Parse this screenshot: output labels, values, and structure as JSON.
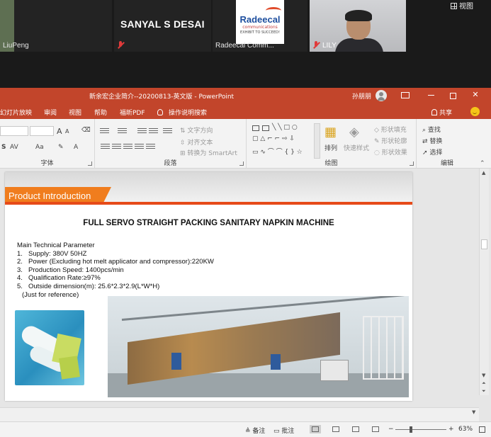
{
  "meeting": {
    "view_label": "视图",
    "participants": [
      {
        "name": "LiuPeng",
        "muted": false
      },
      {
        "name": "SANYAL S DESAI",
        "muted": true
      },
      {
        "name": "Radeecal Comm...",
        "muted": false,
        "logo": {
          "line1": "Radeecal",
          "line2": "communications",
          "line3": "EXHIBIT TO SUCCEED!"
        }
      },
      {
        "name": "LILY",
        "muted": true
      }
    ]
  },
  "app": {
    "title": "新余宏企业简介--20200813-英文版 - PowerPoint",
    "user": "孙朋朋"
  },
  "tabs": [
    "幻灯片放映",
    "审阅",
    "视图",
    "帮助",
    "福昕PDF"
  ],
  "tell_me": "操作说明搜索",
  "share_label": "共享",
  "ribbon": {
    "groups": {
      "font": "字体",
      "paragraph": "段落",
      "drawing": "绘图",
      "editing": "编辑"
    },
    "font": {
      "grow": "A",
      "shrink": "A",
      "strike": "S",
      "spacing": "AV",
      "case": "Aa",
      "color": "A"
    },
    "paragraph": {
      "text_direction": "文字方向",
      "align_text": "对齐文本",
      "smartart": "转换为 SmartArt"
    },
    "drawing": {
      "arrange": "排列",
      "quick_styles": "快速样式",
      "fill": "形状填充",
      "outline": "形状轮廓",
      "effects": "形状效果"
    },
    "editing": {
      "find": "查找",
      "replace": "替换",
      "select": "选择"
    }
  },
  "slide": {
    "tag": "Product Introduction",
    "title": "FULL SERVO STRAIGHT PACKING SANITARY NAPKIN MACHINE",
    "params_heading": "Main Technical Parameter",
    "params": [
      {
        "n": "1.",
        "text": "Supply: 380V  50HZ"
      },
      {
        "n": "2.",
        "text": "Power (Excluding hot melt applicator and compressor):220KW"
      },
      {
        "n": "3.",
        "text": "Production Speed: 1400pcs/min"
      },
      {
        "n": "4.",
        "text": "Qualification Rate:≥97%"
      },
      {
        "n": "5.",
        "text": "Outside dimension(m): 25.6*2.3*2.9(L*W*H)"
      }
    ],
    "note": "(Just for reference)",
    "colors": {
      "accent": "#f07d1e",
      "line": "#e64a19"
    }
  },
  "status": {
    "notes": "备注",
    "comments": "批注",
    "zoom": "63%",
    "zoom_fraction": 0.3
  }
}
